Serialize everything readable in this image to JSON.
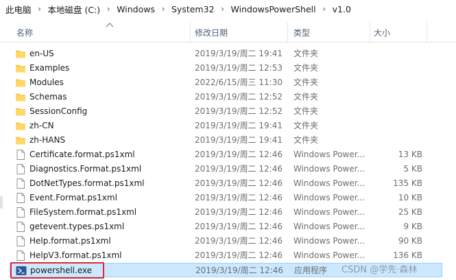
{
  "breadcrumb": {
    "items": [
      "此电脑",
      "本地磁盘 (C:)",
      "Windows",
      "System32",
      "WindowsPowerShell",
      "v1.0"
    ],
    "separator": "›"
  },
  "columns": {
    "name": "名称",
    "date": "修改日期",
    "type": "类型",
    "size": "大小"
  },
  "files": [
    {
      "name": "en-US",
      "date": "2019/3/19/周二 19:41",
      "type": "文件夹",
      "size": "",
      "icon": "folder-icon"
    },
    {
      "name": "Examples",
      "date": "2019/3/19/周二 12:53",
      "type": "文件夹",
      "size": "",
      "icon": "folder-icon"
    },
    {
      "name": "Modules",
      "date": "2022/6/15/周三 11:30",
      "type": "文件夹",
      "size": "",
      "icon": "folder-icon"
    },
    {
      "name": "Schemas",
      "date": "2019/3/19/周二 12:52",
      "type": "文件夹",
      "size": "",
      "icon": "folder-icon"
    },
    {
      "name": "SessionConfig",
      "date": "2019/3/19/周二 12:52",
      "type": "文件夹",
      "size": "",
      "icon": "folder-icon"
    },
    {
      "name": "zh-CN",
      "date": "2019/3/19/周二 19:41",
      "type": "文件夹",
      "size": "",
      "icon": "folder-icon"
    },
    {
      "name": "zh-HANS",
      "date": "2019/3/19/周二 19:41",
      "type": "文件夹",
      "size": "",
      "icon": "folder-icon"
    },
    {
      "name": "Certificate.format.ps1xml",
      "date": "2019/3/19/周二 12:46",
      "type": "Windows Power...",
      "size": "13 KB",
      "icon": "document-icon"
    },
    {
      "name": "Diagnostics.Format.ps1xml",
      "date": "2019/3/19/周二 12:46",
      "type": "Windows Power...",
      "size": "5 KB",
      "icon": "document-icon"
    },
    {
      "name": "DotNetTypes.format.ps1xml",
      "date": "2019/3/19/周二 12:46",
      "type": "Windows Power...",
      "size": "135 KB",
      "icon": "document-icon"
    },
    {
      "name": "Event.Format.ps1xml",
      "date": "2019/3/19/周二 12:46",
      "type": "Windows Power...",
      "size": "10 KB",
      "icon": "document-icon"
    },
    {
      "name": "FileSystem.format.ps1xml",
      "date": "2019/3/19/周二 12:46",
      "type": "Windows Power...",
      "size": "25 KB",
      "icon": "document-icon"
    },
    {
      "name": "getevent.types.ps1xml",
      "date": "2019/3/19/周二 12:46",
      "type": "Windows Power...",
      "size": "9 KB",
      "icon": "document-icon"
    },
    {
      "name": "Help.format.ps1xml",
      "date": "2019/3/19/周二 12:46",
      "type": "Windows Power...",
      "size": "90 KB",
      "icon": "document-icon"
    },
    {
      "name": "HelpV3.format.ps1xml",
      "date": "2019/3/19/周二 12:46",
      "type": "Windows Power...",
      "size": "136 KB",
      "icon": "document-icon"
    },
    {
      "name": "powershell.exe",
      "date": "2019/3/19/周二 12:46",
      "type": "应用程序",
      "size": "",
      "icon": "powershell-icon",
      "selected": true
    }
  ],
  "watermark": "CSDN @学先·森林",
  "colors": {
    "selection": "#cce8ff",
    "selection_border": "#99d1ff",
    "highlight_box": "#e5262d",
    "folder": "#f8c94c",
    "powershell": "#2b5797"
  }
}
